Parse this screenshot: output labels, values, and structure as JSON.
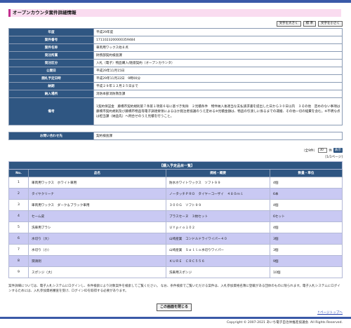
{
  "page": {
    "title": "オープンカウンタ案件詳細情報",
    "font_buttons": [
      "文字を大きく",
      "標 準",
      "文字を小さく"
    ]
  },
  "detail": [
    {
      "label": "年度",
      "value": "平成29年度"
    },
    {
      "label": "案件番号",
      "value": "1711023200000359484"
    },
    {
      "label": "案件名称",
      "value": "車両用ワックス他８点"
    },
    {
      "label": "発注所属",
      "value": "財務部契約検査課"
    },
    {
      "label": "発注区分",
      "value": "入札（電子）物品購入/随意契約（オープンカウンタ）"
    },
    {
      "label": "公開日",
      "value": "平成29年11月15日"
    },
    {
      "label": "開札予定日時",
      "value": "平成29年11月22日　9時00分"
    },
    {
      "label": "納期",
      "value": "平成２９年１２月２５日まで"
    },
    {
      "label": "納入場所",
      "value": "消防本部消防救急課"
    },
    {
      "label": "備考",
      "value": "1契約保証金　藤橋市契約規則第７条第１項第６号に基づき免除　２見積条件　物件納入後適当な支払請求書を提出した日から３０日以内　３その他　定めのない事項は藤橋市契約規則及び藤橋市物品等電子調達要領によるほか発注者協議のうえ定める※見積金額は、物品の引渡しに係るまでの運搬、その他一切の経費を含む。※不明な点は担当課（納品先）へ問合せのうえ見積を行うこと。"
    }
  ],
  "contact": {
    "label": "お問い合わせ先",
    "value": "契約検査課"
  },
  "pager": {
    "prefix": "（全9件）",
    "per_page": "30",
    "suffix": "件",
    "go": "表示",
    "page_info": "[1/1ページ]"
  },
  "items": {
    "caption": "【購入予定品目一覧】",
    "headers": {
      "no": "No.",
      "name": "品名",
      "spec": "規格・概要",
      "qty": "数量・単位"
    },
    "rows": [
      {
        "no": "1",
        "name": "車両用ワックス　ホワイト車用",
        "spec": "防水ホワイトワックス　ソフト９９",
        "qty": "4個"
      },
      {
        "no": "2",
        "name": "タイヤクリーナ",
        "spec": "ノータッチＰＲＯ　タイヤーコーザイ　４８０ｍｌ",
        "qty": "6本"
      },
      {
        "no": "3",
        "name": "車両用ワックス　ダーク＆ブラック車用",
        "spec": "３００Ｇ　ソフト９９",
        "qty": "4個"
      },
      {
        "no": "4",
        "name": "セーム皮",
        "spec": "プラスセーヌ　３枚セット",
        "qty": "6セット"
      },
      {
        "no": "5",
        "name": "洗車用ブラシ",
        "spec": "ＵＹｐｒｏ１０２",
        "qty": "4個"
      },
      {
        "no": "6",
        "name": "水切り（大）",
        "spec": "山崎産業　コンドルドライワイパー４０",
        "qty": "3個"
      },
      {
        "no": "7",
        "name": "水切り（小）",
        "spec": "山崎産業　Ｓｅｌｌｏ水切りワイパー",
        "qty": "3個"
      },
      {
        "no": "8",
        "name": "潤滑剤",
        "spec": "ＫＵＲＥ　ＣＲＣ５５６",
        "qty": "9個"
      },
      {
        "no": "9",
        "name": "スポンジ（大）",
        "spec": "洗車用スポンジ",
        "qty": "10個"
      }
    ]
  },
  "footnote": "案件詳細については、電子入札システムにログインし、条件検索により対象案件を検索してご覧ください。 なお、条件検索でご覧いただける案件は、入札参加資格名簿に登載がある団体のものに限られます。電子入札システムにログインするためには、入札参加資格審査を受け、ログインIDを取得する必要があります。",
  "close_button": "この画面を閉じる",
  "to_top": "↑ページトップへ",
  "copyright": "Copyright © 2007-2021 あいち電子自治体推進協議会. All Rights Reserved.",
  "colors": {
    "accent": "#2f5682",
    "title_bg": "#fadcf0",
    "title_border": "#c32d8e",
    "row_alt": "#c9c9f3",
    "bar": "#3a5aa8"
  }
}
